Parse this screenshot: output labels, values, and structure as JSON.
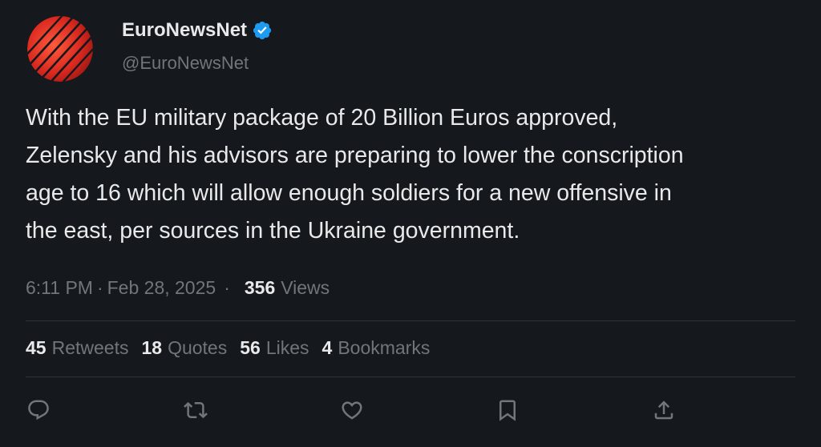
{
  "author": {
    "display_name": "EuroNewsNet",
    "handle": "@EuroNewsNet",
    "verified": true,
    "avatar_icon": "red-striped-globe-logo",
    "verified_icon": "verified-badge-icon",
    "verified_color": "#1d9bf0"
  },
  "tweet": {
    "text": "With the EU military package of 20 Billion Euros approved,\nZelensky and his advisors are preparing to lower the conscription\nage to 16 which will allow enough soldiers for a new offensive in\nthe east, per sources in the Ukraine government.",
    "time": "6:11 PM",
    "date": "Feb 28, 2025",
    "date_separator": "·",
    "meta_separator": "·",
    "views_count": "356",
    "views_label": "Views"
  },
  "stats": {
    "retweets": {
      "count": "45",
      "label": "Retweets"
    },
    "quotes": {
      "count": "18",
      "label": "Quotes"
    },
    "likes": {
      "count": "56",
      "label": "Likes"
    },
    "bookmarks": {
      "count": "4",
      "label": "Bookmarks"
    }
  },
  "actions": [
    {
      "name": "reply",
      "icon": "reply-icon"
    },
    {
      "name": "retweet",
      "icon": "retweet-icon"
    },
    {
      "name": "like",
      "icon": "heart-icon"
    },
    {
      "name": "bookmark",
      "icon": "bookmark-icon"
    },
    {
      "name": "share",
      "icon": "share-icon"
    }
  ],
  "colors": {
    "background": "#15181c",
    "text_primary": "#e7e9ea",
    "text_secondary": "#71767b",
    "divider": "#2f3336",
    "avatar_red": "#e0342b"
  }
}
